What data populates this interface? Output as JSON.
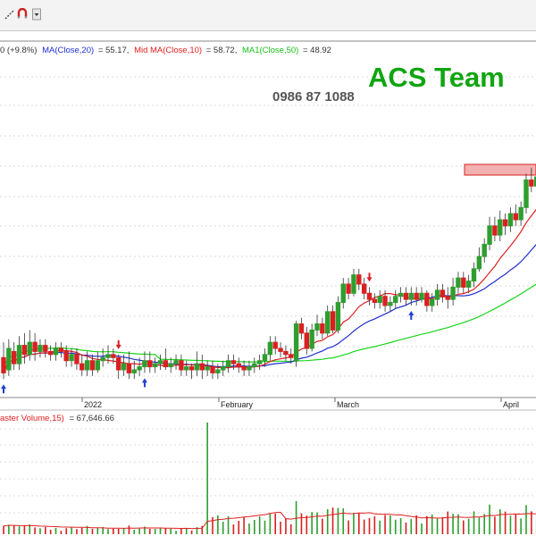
{
  "toolbar": {
    "icons": [
      "draw-line-icon",
      "magnet-icon",
      "dropdown-icon"
    ]
  },
  "header": {
    "legend_text_1": "0 (+9.8%)",
    "ma20_label": "MA(Close,20)",
    "ma20_value": "= 55.17,",
    "mid_ma10_label": "Mid MA(Close,10)",
    "mid_ma10_value": "= 58.72,",
    "ma50_label": "MA1(Close,50)",
    "ma50_value": "= 48.92"
  },
  "watermark": {
    "brand": "ACS Team",
    "phone": "0986 87 1088"
  },
  "volume_panel": {
    "label": "aster Volume,15)",
    "value": "= 67,646.66"
  },
  "colors": {
    "up_candle": "#2e9e2e",
    "down_candle": "#d82020",
    "ma20": "#1f2fd0",
    "ma10": "#e02020",
    "ma50": "#19d419",
    "brand": "#11a511",
    "phone": "#555555",
    "signal_up": "#1f3fd0",
    "signal_down": "#d82020",
    "resistance_zone": "#f3b0b0"
  },
  "chart_data": {
    "type": "candlestick",
    "x_tick_labels": [
      "2022",
      "February",
      "March",
      "April"
    ],
    "series": [
      {
        "name": "MA(Close,20)",
        "last": 55.17
      },
      {
        "name": "Mid MA(Close,10)",
        "last": 58.72
      },
      {
        "name": "MA1(Close,50)",
        "last": 48.92
      }
    ],
    "candles": [
      {
        "o": 387,
        "c": 382,
        "h": 392,
        "l": 380
      },
      {
        "o": 383,
        "c": 390,
        "h": 393,
        "l": 381
      },
      {
        "o": 389,
        "c": 385,
        "h": 392,
        "l": 383
      },
      {
        "o": 385,
        "c": 391,
        "h": 394,
        "l": 383
      },
      {
        "o": 391,
        "c": 388,
        "h": 395,
        "l": 385
      },
      {
        "o": 388,
        "c": 392,
        "h": 396,
        "l": 386
      },
      {
        "o": 392,
        "c": 389,
        "h": 395,
        "l": 386
      },
      {
        "o": 389,
        "c": 391,
        "h": 393,
        "l": 387
      },
      {
        "o": 391,
        "c": 389,
        "h": 393,
        "l": 387
      },
      {
        "o": 389,
        "c": 388,
        "h": 391,
        "l": 386
      },
      {
        "o": 388,
        "c": 390,
        "h": 392,
        "l": 386
      },
      {
        "o": 390,
        "c": 389,
        "h": 392,
        "l": 387
      },
      {
        "o": 389,
        "c": 386,
        "h": 391,
        "l": 384
      },
      {
        "o": 386,
        "c": 388,
        "h": 390,
        "l": 384
      },
      {
        "o": 388,
        "c": 385,
        "h": 390,
        "l": 383
      },
      {
        "o": 385,
        "c": 383,
        "h": 388,
        "l": 381
      },
      {
        "o": 383,
        "c": 386,
        "h": 389,
        "l": 381
      },
      {
        "o": 386,
        "c": 383,
        "h": 388,
        "l": 381
      },
      {
        "o": 383,
        "c": 386,
        "h": 389,
        "l": 382
      },
      {
        "o": 386,
        "c": 387,
        "h": 390,
        "l": 384
      },
      {
        "o": 387,
        "c": 388,
        "h": 391,
        "l": 385
      },
      {
        "o": 388,
        "c": 387,
        "h": 390,
        "l": 385
      },
      {
        "o": 387,
        "c": 383,
        "h": 388,
        "l": 380
      },
      {
        "o": 383,
        "c": 385,
        "h": 388,
        "l": 381
      },
      {
        "o": 385,
        "c": 382,
        "h": 389,
        "l": 380
      },
      {
        "o": 382,
        "c": 383,
        "h": 386,
        "l": 380
      },
      {
        "o": 383,
        "c": 384,
        "h": 387,
        "l": 381
      },
      {
        "o": 384,
        "c": 386,
        "h": 389,
        "l": 382
      },
      {
        "o": 386,
        "c": 384,
        "h": 389,
        "l": 382
      },
      {
        "o": 384,
        "c": 385,
        "h": 387,
        "l": 382
      },
      {
        "o": 385,
        "c": 386,
        "h": 388,
        "l": 383
      },
      {
        "o": 386,
        "c": 384,
        "h": 390,
        "l": 383
      },
      {
        "o": 384,
        "c": 385,
        "h": 387,
        "l": 382
      },
      {
        "o": 385,
        "c": 386,
        "h": 388,
        "l": 383
      },
      {
        "o": 386,
        "c": 383,
        "h": 388,
        "l": 381
      },
      {
        "o": 383,
        "c": 384,
        "h": 386,
        "l": 381
      },
      {
        "o": 384,
        "c": 383,
        "h": 385,
        "l": 380
      },
      {
        "o": 383,
        "c": 385,
        "h": 389,
        "l": 381
      },
      {
        "o": 385,
        "c": 383,
        "h": 388,
        "l": 380
      },
      {
        "o": 383,
        "c": 384,
        "h": 386,
        "l": 381
      },
      {
        "o": 384,
        "c": 382,
        "h": 386,
        "l": 380
      },
      {
        "o": 382,
        "c": 383,
        "h": 385,
        "l": 380
      },
      {
        "o": 383,
        "c": 384,
        "h": 386,
        "l": 381
      },
      {
        "o": 384,
        "c": 386,
        "h": 388,
        "l": 382
      },
      {
        "o": 386,
        "c": 385,
        "h": 388,
        "l": 383
      },
      {
        "o": 385,
        "c": 384,
        "h": 387,
        "l": 382
      },
      {
        "o": 384,
        "c": 383,
        "h": 386,
        "l": 381
      },
      {
        "o": 383,
        "c": 384,
        "h": 386,
        "l": 381
      },
      {
        "o": 384,
        "c": 385,
        "h": 387,
        "l": 382
      },
      {
        "o": 385,
        "c": 386,
        "h": 388,
        "l": 383
      },
      {
        "o": 386,
        "c": 388,
        "h": 390,
        "l": 384
      },
      {
        "o": 388,
        "c": 392,
        "h": 394,
        "l": 386
      },
      {
        "o": 392,
        "c": 390,
        "h": 394,
        "l": 388
      },
      {
        "o": 390,
        "c": 389,
        "h": 392,
        "l": 387
      },
      {
        "o": 389,
        "c": 388,
        "h": 391,
        "l": 386
      },
      {
        "o": 388,
        "c": 387,
        "h": 390,
        "l": 385
      },
      {
        "o": 386,
        "c": 398,
        "h": 399,
        "l": 384
      },
      {
        "o": 398,
        "c": 395,
        "h": 400,
        "l": 393
      },
      {
        "o": 395,
        "c": 390,
        "h": 397,
        "l": 388
      },
      {
        "o": 390,
        "c": 396,
        "h": 398,
        "l": 389
      },
      {
        "o": 396,
        "c": 398,
        "h": 401,
        "l": 394
      },
      {
        "o": 398,
        "c": 395,
        "h": 400,
        "l": 393
      },
      {
        "o": 395,
        "c": 402,
        "h": 404,
        "l": 394
      },
      {
        "o": 402,
        "c": 396,
        "h": 404,
        "l": 395
      },
      {
        "o": 396,
        "c": 405,
        "h": 407,
        "l": 395
      },
      {
        "o": 405,
        "c": 411,
        "h": 413,
        "l": 403
      },
      {
        "o": 411,
        "c": 408,
        "h": 413,
        "l": 406
      },
      {
        "o": 408,
        "c": 414,
        "h": 416,
        "l": 407
      },
      {
        "o": 414,
        "c": 411,
        "h": 416,
        "l": 409
      },
      {
        "o": 411,
        "c": 408,
        "h": 413,
        "l": 406
      },
      {
        "o": 408,
        "c": 406,
        "h": 410,
        "l": 404
      },
      {
        "o": 406,
        "c": 405,
        "h": 408,
        "l": 403
      },
      {
        "o": 405,
        "c": 407,
        "h": 409,
        "l": 403
      },
      {
        "o": 407,
        "c": 404,
        "h": 409,
        "l": 402
      },
      {
        "o": 404,
        "c": 405,
        "h": 407,
        "l": 402
      },
      {
        "o": 405,
        "c": 407,
        "h": 409,
        "l": 403
      },
      {
        "o": 407,
        "c": 408,
        "h": 410,
        "l": 405
      },
      {
        "o": 408,
        "c": 406,
        "h": 410,
        "l": 404
      },
      {
        "o": 406,
        "c": 408,
        "h": 410,
        "l": 404
      },
      {
        "o": 408,
        "c": 406,
        "h": 410,
        "l": 404
      },
      {
        "o": 406,
        "c": 408,
        "h": 410,
        "l": 405
      },
      {
        "o": 408,
        "c": 404,
        "h": 409,
        "l": 402
      },
      {
        "o": 404,
        "c": 406,
        "h": 408,
        "l": 402
      },
      {
        "o": 406,
        "c": 409,
        "h": 411,
        "l": 404
      },
      {
        "o": 409,
        "c": 407,
        "h": 411,
        "l": 405
      },
      {
        "o": 407,
        "c": 406,
        "h": 410,
        "l": 403
      },
      {
        "o": 406,
        "c": 410,
        "h": 413,
        "l": 404
      },
      {
        "o": 410,
        "c": 413,
        "h": 415,
        "l": 408
      },
      {
        "o": 413,
        "c": 410,
        "h": 415,
        "l": 408
      },
      {
        "o": 410,
        "c": 412,
        "h": 414,
        "l": 408
      },
      {
        "o": 412,
        "c": 416,
        "h": 418,
        "l": 410
      },
      {
        "o": 416,
        "c": 420,
        "h": 423,
        "l": 415
      },
      {
        "o": 420,
        "c": 424,
        "h": 426,
        "l": 418
      },
      {
        "o": 424,
        "c": 430,
        "h": 433,
        "l": 422
      },
      {
        "o": 430,
        "c": 427,
        "h": 433,
        "l": 425
      },
      {
        "o": 427,
        "c": 432,
        "h": 435,
        "l": 425
      },
      {
        "o": 432,
        "c": 430,
        "h": 434,
        "l": 427
      },
      {
        "o": 430,
        "c": 434,
        "h": 436,
        "l": 428
      },
      {
        "o": 434,
        "c": 432,
        "h": 437,
        "l": 430
      },
      {
        "o": 432,
        "c": 436,
        "h": 438,
        "l": 430
      },
      {
        "o": 436,
        "c": 445,
        "h": 447,
        "l": 434
      },
      {
        "o": 445,
        "c": 443,
        "h": 449,
        "l": 441
      },
      {
        "o": 443,
        "c": 446,
        "h": 448,
        "l": 441
      },
      {
        "o": 446,
        "c": 458,
        "h": 462,
        "l": 444
      },
      {
        "o": 458,
        "c": 457,
        "h": 462,
        "l": 454
      },
      {
        "o": 457,
        "c": 454,
        "h": 460,
        "l": 452
      },
      {
        "o": 454,
        "c": 446,
        "h": 458,
        "l": 443
      }
    ],
    "volume_line_level": "low",
    "signals": [
      {
        "type": "up",
        "index": 0
      },
      {
        "type": "down",
        "index": 22
      },
      {
        "type": "up",
        "index": 27
      },
      {
        "type": "down",
        "index": 70
      },
      {
        "type": "up",
        "index": 78
      }
    ]
  }
}
